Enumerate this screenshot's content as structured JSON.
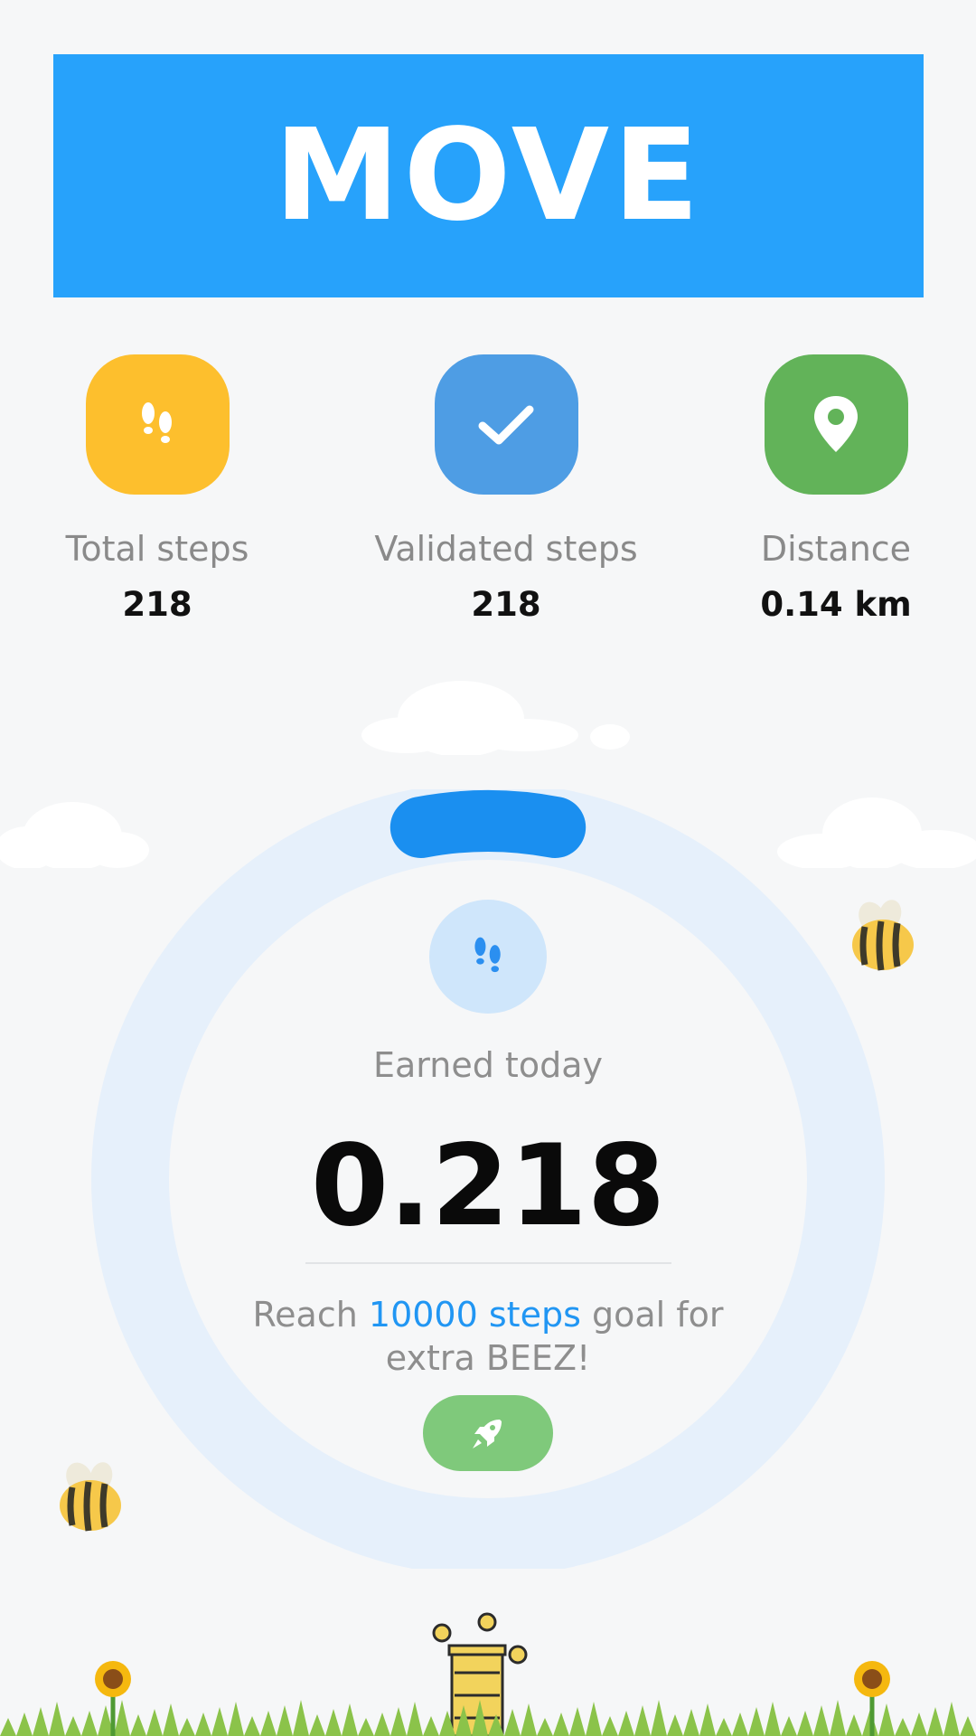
{
  "header": {
    "title": "MOVE"
  },
  "stats": [
    {
      "label": "Total steps",
      "value": "218",
      "icon": "footsteps-icon",
      "color": "#fdbf2d"
    },
    {
      "label": "Validated steps",
      "value": "218",
      "icon": "check-icon",
      "color": "#4e9de4"
    },
    {
      "label": "Distance",
      "value": "0.14 km",
      "icon": "location-pin-icon",
      "color": "#62b359"
    }
  ],
  "earned": {
    "label": "Earned today",
    "value": "0.218",
    "icon": "footsteps-icon",
    "goal_prefix": "Reach ",
    "goal_highlight": "10000 steps",
    "goal_suffix": " goal for extra BEEZ!",
    "progress": 0.0218
  },
  "boost_button": {
    "icon": "rocket-icon",
    "color": "#7fc97b"
  },
  "colors": {
    "banner": "#27a2fb",
    "ring_track": "#e6f0fb",
    "ring_progress": "#1a8ff0",
    "highlight": "#2196f3"
  }
}
